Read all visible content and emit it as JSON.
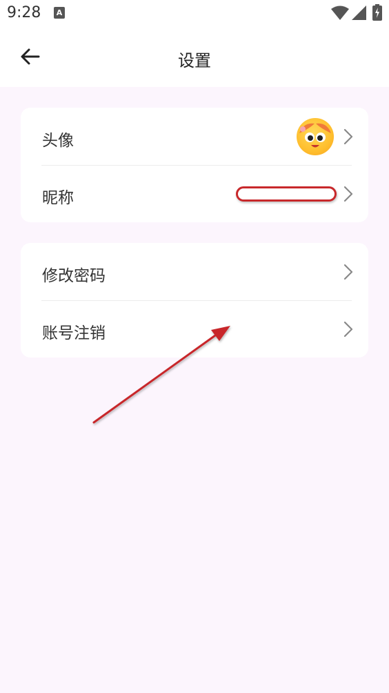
{
  "status_bar": {
    "time": "9:28",
    "notification_glyph": "A"
  },
  "app_bar": {
    "title": "设置"
  },
  "profile_card": {
    "avatar_label": "头像",
    "nickname_label": "昵称"
  },
  "account_card": {
    "change_password_label": "修改密码",
    "cancel_account_label": "账号注销"
  },
  "colors": {
    "page_background": "#fcf5fd",
    "card_background": "#ffffff",
    "annotation_red": "#c8282b"
  },
  "icons": [
    "back-arrow-icon",
    "chevron-right-icon",
    "wifi-icon",
    "signal-icon",
    "battery-icon"
  ]
}
